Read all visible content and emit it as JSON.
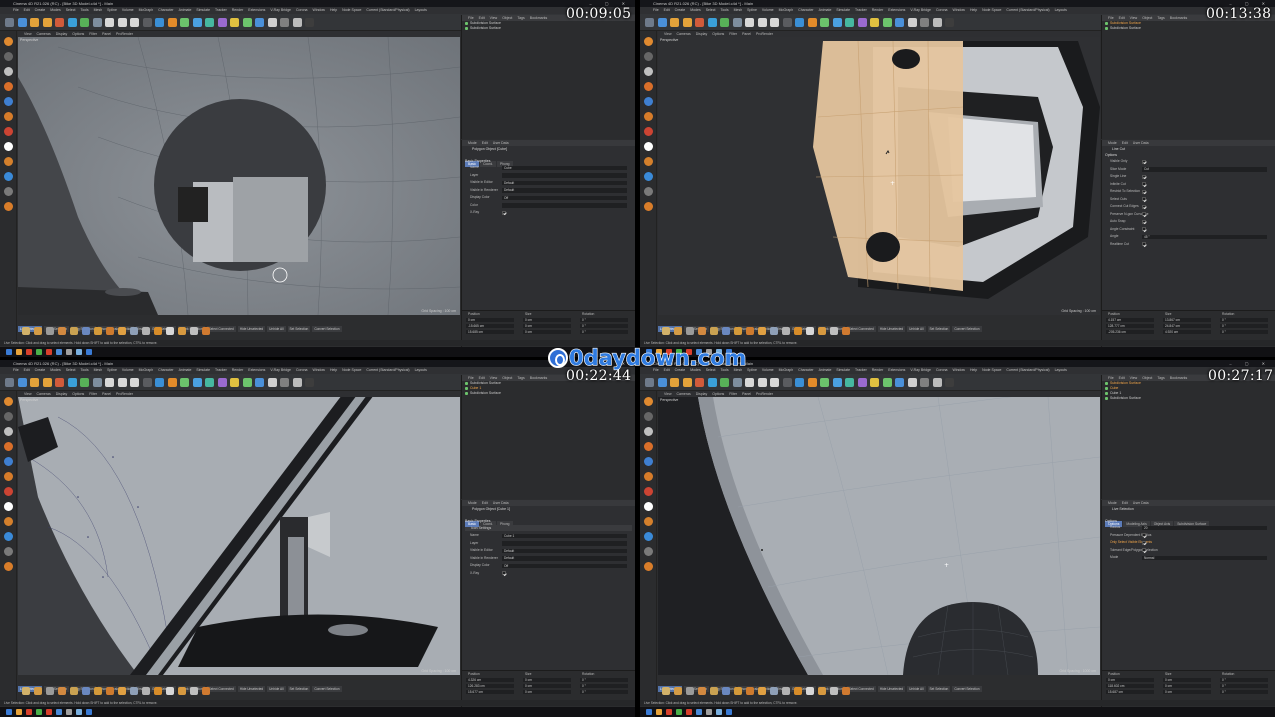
{
  "window_title": "Cinema 4D R21.026 (RC) - [Bike 3D Model.c4d *] - Main",
  "window_buttons": "– ▢ ✕",
  "menu": [
    "File",
    "Edit",
    "Create",
    "Modes",
    "Select",
    "Tools",
    "Mesh",
    "Spline",
    "Volume",
    "MoGraph",
    "Character",
    "Animate",
    "Simulate",
    "Tracker",
    "Render",
    "Extensions",
    "V-Ray Bridge",
    "Corona",
    "Window",
    "Help"
  ],
  "node_space_label": "Node Space",
  "node_space_value": "Current (Standard/Physical)",
  "layouts_label": "Layouts",
  "viewport_menu": [
    "View",
    "Cameras",
    "Display",
    "Options",
    "Filter",
    "Panel",
    "ProRender"
  ],
  "viewport_label": "Perspective",
  "object_manager_menu": [
    "File",
    "Edit",
    "View",
    "Object",
    "Tags",
    "Bookmarks"
  ],
  "attr_menu": [
    "Mode",
    "Edit",
    "User Data"
  ],
  "coord_headers": [
    "Position",
    "Size",
    "Rotation"
  ],
  "coord_buttons": [
    "World",
    "Size",
    "Apply"
  ],
  "selection_tools": [
    "Live Selection",
    "Loop Selection",
    "Ring Selection",
    "Phong Break Selection",
    "Invert",
    "Grow Selection",
    "Shrink Selection",
    "Select Connected",
    "Hide Unselected",
    "Unhide All",
    "Set Selection",
    "Convert Selection"
  ],
  "status_text": "Live Selection: Click and drag to select elements. Hold down SHIFT to add to the selection, CTRL to remove.",
  "watermark": "0daydown.com",
  "panels": [
    {
      "timestamp": "00:09:05",
      "grid_spacing": "Grid Spacing : 100 cm",
      "objects": [
        {
          "name": "Subdivision Surface",
          "selected": false
        },
        {
          "name": "Subdivision Surface",
          "selected": false
        }
      ],
      "attr_title": "Polygon Object [Cube]",
      "attr_tabs": [
        {
          "label": "Basic",
          "on": true
        },
        {
          "label": "Coord.",
          "on": false
        },
        {
          "label": "Phong",
          "on": false
        }
      ],
      "attr_section": "Basic Properties",
      "attr_sub": "",
      "attr_rows": [
        {
          "label": "Name",
          "value": "Cube",
          "type": "field",
          "orange": false
        },
        {
          "label": "Layer",
          "value": "",
          "type": "field",
          "orange": false
        },
        {
          "label": "Visible in Editor",
          "value": "Default",
          "type": "field",
          "orange": false
        },
        {
          "label": "Visible in Renderer",
          "value": "Default",
          "type": "field",
          "orange": false
        },
        {
          "label": "Display Color",
          "value": "Off",
          "type": "field",
          "orange": false
        },
        {
          "label": "Color",
          "value": "",
          "type": "field",
          "orange": false
        },
        {
          "label": "X-Ray",
          "value": "",
          "type": "check",
          "orange": false
        }
      ],
      "coords": [
        [
          "0 cm",
          "0 cm",
          "0 °"
        ],
        [
          "-15.665 cm",
          "0 cm",
          "0 °"
        ],
        [
          "15.685 cm",
          "0 cm",
          "0 °"
        ]
      ]
    },
    {
      "timestamp": "00:13:38",
      "grid_spacing": "Grid Spacing : 100 cm",
      "objects": [
        {
          "name": "Subdivision Surface",
          "selected": true
        },
        {
          "name": "Subdivision Surface",
          "selected": false
        }
      ],
      "attr_title": "Line Cut",
      "attr_tabs": [],
      "attr_section": "Options",
      "attr_sub": "",
      "attr_rows": [
        {
          "label": "Visible Only",
          "value": "",
          "type": "check",
          "orange": false
        },
        {
          "label": "Slice Mode",
          "value": "Cut",
          "type": "field",
          "orange": false
        },
        {
          "label": "Single Line",
          "value": "",
          "type": "check",
          "orange": false
        },
        {
          "label": "Infinite Cut",
          "value": "",
          "type": "check",
          "orange": false
        },
        {
          "label": "Restrict To Selection",
          "value": "",
          "type": "check",
          "orange": false
        },
        {
          "label": "Select Cuts",
          "value": "",
          "type": "check",
          "orange": false
        },
        {
          "label": "Connect Cut Edges",
          "value": "",
          "type": "check",
          "orange": false
        },
        {
          "label": "Preserve N-gon Curvature",
          "value": "",
          "type": "check",
          "orange": false
        },
        {
          "label": "Auto Snap",
          "value": "",
          "type": "check",
          "orange": false
        },
        {
          "label": "Angle Constraint",
          "value": "",
          "type": "check",
          "orange": false
        },
        {
          "label": "Angle",
          "value": "45 °",
          "type": "field",
          "orange": false
        },
        {
          "label": "Realtime Cut",
          "value": "",
          "type": "check",
          "orange": false
        }
      ],
      "coords": [
        [
          "4.157 cm",
          "13.867 cm",
          "0 °"
        ],
        [
          "128.777 cm",
          "24.847 cm",
          "0 °"
        ],
        [
          "-205.236 cm",
          "4.920 cm",
          "0 °"
        ]
      ]
    },
    {
      "timestamp": "00:22:44",
      "grid_spacing": "Grid Spacing : 100 cm",
      "objects": [
        {
          "name": "Subdivision Surface",
          "selected": false
        },
        {
          "name": "Cube 1",
          "selected": true
        },
        {
          "name": "Subdivision Surface",
          "selected": false
        }
      ],
      "attr_title": "Polygon Object [Cube 1]",
      "attr_tabs": [
        {
          "label": "Basic",
          "on": true
        },
        {
          "label": "Coord.",
          "on": false
        },
        {
          "label": "Phong",
          "on": false
        }
      ],
      "attr_section": "Basic Properties",
      "attr_sub": "Icon Settings",
      "attr_rows": [
        {
          "label": "Name",
          "value": "Cube 1",
          "type": "field",
          "orange": false
        },
        {
          "label": "Layer",
          "value": "",
          "type": "field",
          "orange": false
        },
        {
          "label": "Visible in Editor",
          "value": "Default",
          "type": "field",
          "orange": false
        },
        {
          "label": "Visible in Renderer",
          "value": "Default",
          "type": "field",
          "orange": false
        },
        {
          "label": "Display Color",
          "value": "Off",
          "type": "field",
          "orange": false
        },
        {
          "label": "X-Ray",
          "value": "",
          "type": "check",
          "orange": false
        }
      ],
      "coords": [
        [
          "4.326 cm",
          "0 cm",
          "0 °"
        ],
        [
          "126.283 cm",
          "0 cm",
          "0 °"
        ],
        [
          "15.677 cm",
          "0 cm",
          "0 °"
        ]
      ]
    },
    {
      "timestamp": "00:27:17",
      "grid_spacing": "Grid Spacing : 1000 cm",
      "objects": [
        {
          "name": "Subdivision Surface",
          "selected": true
        },
        {
          "name": "Cube",
          "selected": true
        },
        {
          "name": "Cube 1",
          "selected": false
        },
        {
          "name": "Subdivision Surface",
          "selected": false
        }
      ],
      "attr_title": "Live Selection",
      "attr_tabs": [
        {
          "label": "Options",
          "on": true
        },
        {
          "label": "Modeling Axis",
          "on": false
        },
        {
          "label": "Object Axis",
          "on": false
        },
        {
          "label": "Subdivision Surface",
          "on": false
        }
      ],
      "attr_section": "Options",
      "attr_sub": "",
      "attr_rows": [
        {
          "label": "Radius",
          "value": "20",
          "type": "field",
          "orange": false
        },
        {
          "label": "Pressure Dependent Radius",
          "value": "",
          "type": "check",
          "orange": false
        },
        {
          "label": "Only Select Visible Elements",
          "value": "",
          "type": "check",
          "orange": true
        },
        {
          "label": "Tolerant Edge/Polygon Selection",
          "value": "",
          "type": "check",
          "orange": false
        },
        {
          "label": "Mode",
          "value": "Normal",
          "type": "field",
          "orange": false
        }
      ],
      "coords": [
        [
          "0 cm",
          "0 cm",
          "0 °"
        ],
        [
          "118.602 cm",
          "0 cm",
          "0 °"
        ],
        [
          "15.687 cm",
          "0 cm",
          "0 °"
        ]
      ]
    }
  ]
}
